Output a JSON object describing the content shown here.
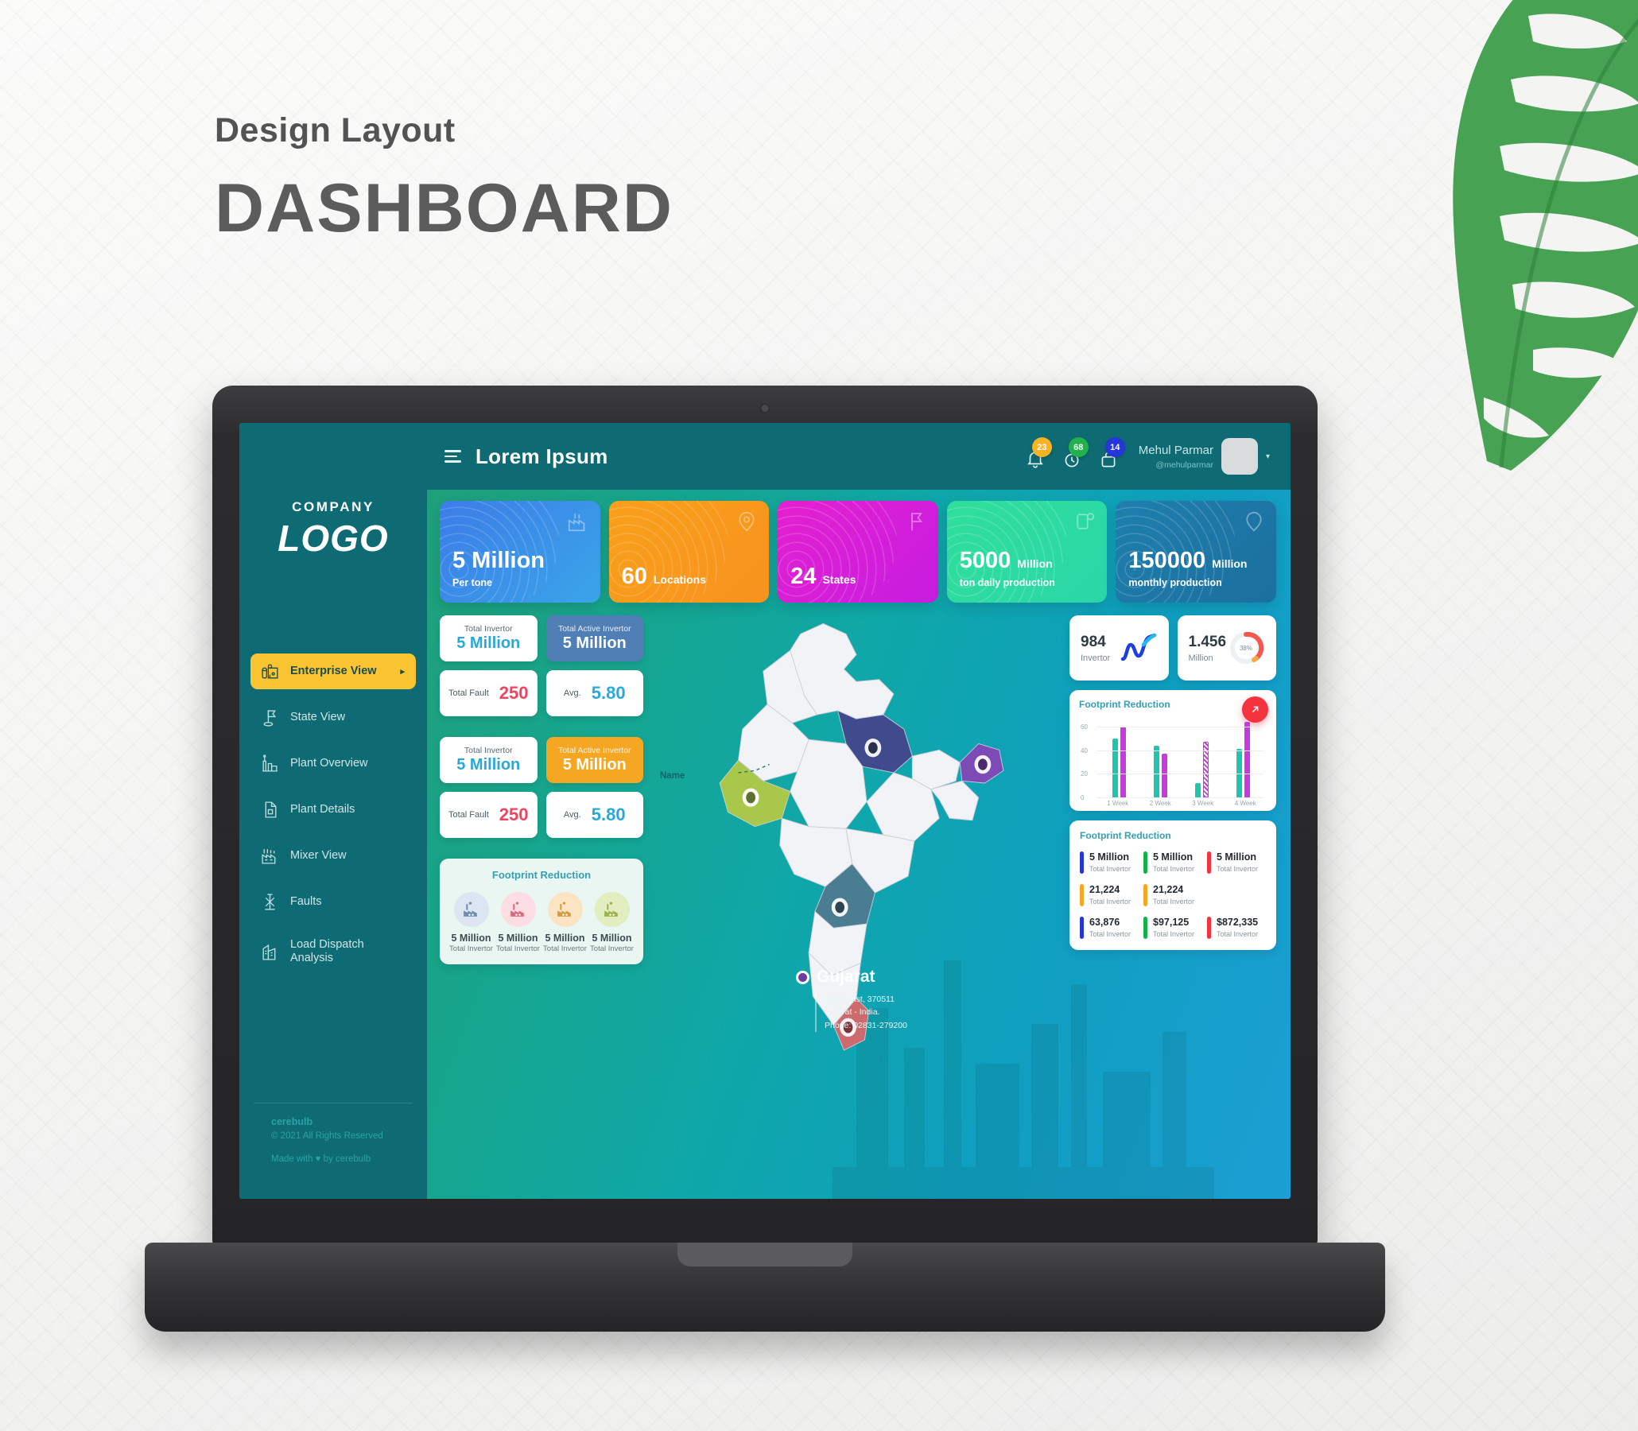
{
  "poster": {
    "subtitle": "Design Layout",
    "title": "DASHBOARD"
  },
  "sidebar": {
    "company_label": "COMPANY",
    "logo_text": "LOGO",
    "items": [
      {
        "label": "Enterprise View",
        "icon": "factory-tanks-icon",
        "active": true,
        "caret": "▸"
      },
      {
        "label": "State View",
        "icon": "flag-pin-icon",
        "active": false
      },
      {
        "label": "Plant Overview",
        "icon": "plant-chart-icon",
        "active": false
      },
      {
        "label": "Plant Details",
        "icon": "document-icon",
        "active": false
      },
      {
        "label": "Mixer View",
        "icon": "factory-icon",
        "active": false
      },
      {
        "label": "Faults",
        "icon": "fault-tower-icon",
        "active": false
      },
      {
        "label": "Load Dispatch Analysis",
        "icon": "buildings-icon",
        "active": false
      }
    ],
    "footer": {
      "brand": "cerebulb",
      "copyright": "© 2021 All Rights Reserved",
      "made_with": "Made with ♥ by cerebulb"
    }
  },
  "topbar": {
    "menu_icon": "hamburger-icon",
    "title": "Lorem Ipsum",
    "notifications": [
      {
        "icon": "bell-icon",
        "count": "23",
        "color": "#f5b426"
      },
      {
        "icon": "clock-icon",
        "count": "68",
        "color": "#22b14c"
      },
      {
        "icon": "bag-icon",
        "count": "14",
        "color": "#2536d8"
      }
    ],
    "user": {
      "name": "Mehul Parmar",
      "handle": "@mehulparmar",
      "caret": "▾"
    }
  },
  "kpis": [
    {
      "value": "5 Million",
      "unit": "",
      "sub": "Per tone",
      "color1": "#3c7ce8",
      "color2": "#3aa5e8",
      "icon": "factory-icon"
    },
    {
      "value": "60",
      "unit": "Locations",
      "sub": "",
      "color1": "#f9a01b",
      "color2": "#f7921e",
      "icon": "map-pin-icon"
    },
    {
      "value": "24",
      "unit": "States",
      "sub": "",
      "color1": "#e421cf",
      "color2": "#c61ce0",
      "icon": "flag-icon"
    },
    {
      "value": "5000",
      "unit": "Million",
      "sub": "ton daily production",
      "color1": "#2fdf9b",
      "color2": "#2bd6a8",
      "icon": "gauge-gear-icon"
    },
    {
      "value": "150000",
      "unit": "Million",
      "sub": "monthly production",
      "color1": "#1f7fae",
      "color2": "#1b6f9e",
      "icon": "pin-icon"
    }
  ],
  "left_metrics": {
    "block1": [
      {
        "label": "Total Invertor",
        "value": "5 Million",
        "style": "white"
      },
      {
        "label": "Total Active Invertor",
        "value": "5 Million",
        "style": "blue"
      },
      {
        "label": "Total Fault",
        "value": "250",
        "style": "row-red"
      },
      {
        "label": "Avg.",
        "value": "5.80",
        "style": "row-teal"
      }
    ],
    "block2": [
      {
        "label": "Total Invertor",
        "value": "5 Million",
        "style": "white"
      },
      {
        "label": "Total Active Invertor",
        "value": "5 Million",
        "style": "amber"
      },
      {
        "label": "Total Fault",
        "value": "250",
        "style": "row-red"
      },
      {
        "label": "Avg.",
        "value": "5.80",
        "style": "row-teal"
      }
    ]
  },
  "footprint_left": {
    "title": "Footprint Reduction",
    "items": [
      {
        "value": "5 Million",
        "sub": "Total Invertor",
        "bg": "#dbe6f2",
        "fg": "#6f8db3"
      },
      {
        "value": "5 Million",
        "sub": "Total Invertor",
        "bg": "#fbdde3",
        "fg": "#d9697f"
      },
      {
        "value": "5 Million",
        "sub": "Total Invertor",
        "bg": "#fbe4c4",
        "fg": "#d79b3e"
      },
      {
        "value": "5 Million",
        "sub": "Total Invertor",
        "bg": "#e2edc0",
        "fg": "#9bb24d"
      }
    ]
  },
  "map": {
    "name_label": "Name",
    "location": {
      "title": "Gujarat",
      "line1": "Kutch Dist, 370511",
      "line2": "Gujarat - India.",
      "line3": "Phone: 02831-279200"
    }
  },
  "right_cards": [
    {
      "value": "984",
      "label": "Invertor",
      "icon": "line-chart-icon"
    },
    {
      "value": "1.456",
      "label": "Million",
      "icon": "donut-gauge-icon",
      "percent": "38%"
    }
  ],
  "chart_card": {
    "title": "Footprint Reduction",
    "fab_icon": "arrow-up-right-icon"
  },
  "chart_data": {
    "type": "bar",
    "title": "Footprint Reduction",
    "categories": [
      "1 Week",
      "2 Week",
      "3 Week",
      "4 Week"
    ],
    "series": [
      {
        "name": "Teal",
        "color": "#22c4ab",
        "values": [
          50,
          44,
          12,
          41
        ]
      },
      {
        "name": "Magenta",
        "color": "#c63ae0",
        "values": [
          60,
          37,
          47,
          64
        ]
      }
    ],
    "yticks": [
      0,
      20,
      40,
      60
    ],
    "ylim": [
      0,
      70
    ],
    "grid": true,
    "legend": "none",
    "xlabel": "",
    "ylabel": ""
  },
  "legend_card": {
    "title": "Footprint Reduction",
    "items": [
      {
        "value": "5 Million",
        "sub": "Total Invertor",
        "color": "#2536d8"
      },
      {
        "value": "5 Million",
        "sub": "Total Invertor",
        "color": "#16b04a"
      },
      {
        "value": "5 Million",
        "sub": "Total Invertor",
        "color": "#f5333f"
      },
      {
        "value": "21,224",
        "sub": "Total Invertor",
        "color": "#f5a623"
      },
      {
        "value": "21,224",
        "sub": "Total Invertor",
        "color": "#f5a623"
      },
      {
        "value": "",
        "sub": "",
        "color": ""
      },
      {
        "value": "63,876",
        "sub": "Total Invertor",
        "color": "#2536d8"
      },
      {
        "value": "$97,125",
        "sub": "Total Invertor",
        "color": "#16b04a"
      },
      {
        "value": "$872,335",
        "sub": "Total Invertor",
        "color": "#f5333f"
      }
    ]
  }
}
